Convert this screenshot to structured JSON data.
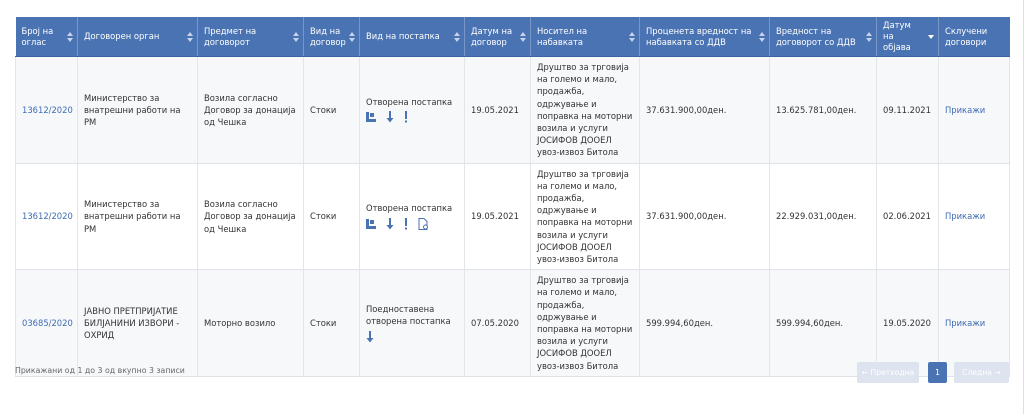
{
  "table": {
    "headers": [
      {
        "label": "Број на оглас",
        "sort": "both"
      },
      {
        "label": "Договорен орган",
        "sort": "both"
      },
      {
        "label": "Предмет на договорот",
        "sort": "both"
      },
      {
        "label": "Вид на договор",
        "sort": "both"
      },
      {
        "label": "Вид на постапка",
        "sort": "both"
      },
      {
        "label": "Датум на договор",
        "sort": "both"
      },
      {
        "label": "Носител на набавката",
        "sort": "both"
      },
      {
        "label": "Проценета вредност на набавката со ДДВ",
        "sort": "both"
      },
      {
        "label": "Вредност на договорот со ДДВ",
        "sort": "both"
      },
      {
        "label": "Датум на објава",
        "sort": "desc"
      },
      {
        "label": "Склучени договори",
        "sort": "none"
      }
    ],
    "rows": [
      {
        "notice": "13612/2020",
        "authority": "Министерство за внатрешни работи на РМ",
        "subject": "Возила согласно Договор за донација од Чешка",
        "contract_type": "Стоки",
        "procedure": "Отворена постапка",
        "procedure_icons": [
          "corner-doc-icon",
          "download-arrow-icon",
          "exclamation-icon"
        ],
        "contract_date": "19.05.2021",
        "holder": "Друштво за трговија на големо и мало, продажба, одржување и поправка на моторни возила и услуги ЈОСИФОВ ДООЕЛ увоз-извоз Битола",
        "estimated": "37.631.900,00ден.",
        "value": "13.625.781,00ден.",
        "published": "09.11.2021",
        "link": "Прикажи"
      },
      {
        "notice": "13612/2020",
        "authority": "Министерство за внатрешни работи на РМ",
        "subject": "Возила согласно Договор за донација од Чешка",
        "contract_type": "Стоки",
        "procedure": "Отворена постапка",
        "procedure_icons": [
          "corner-doc-icon",
          "download-arrow-icon",
          "exclamation-icon",
          "document-gear-icon"
        ],
        "contract_date": "19.05.2021",
        "holder": "Друштво за трговија на големо и мало, продажба, одржување и поправка на моторни возила и услуги ЈОСИФОВ ДООЕЛ увоз-извоз Битола",
        "estimated": "37.631.900,00ден.",
        "value": "22.929.031,00ден.",
        "published": "02.06.2021",
        "link": "Прикажи"
      },
      {
        "notice": "03685/2020",
        "authority": "ЈАВНО ПРЕТПРИЈАТИЕ БИЛЈАНИНИ ИЗВОРИ - ОХРИД",
        "subject": "Моторно возило",
        "contract_type": "Стоки",
        "procedure": "Поедноставена отворена постапка",
        "procedure_icons": [
          "download-arrow-icon"
        ],
        "contract_date": "07.05.2020",
        "holder": "Друштво за трговија на големо и мало, продажба, одржување и поправка на моторни возила и услуги ЈОСИФОВ ДООЕЛ увоз-извоз Битола",
        "estimated": "599.994,60ден.",
        "value": "599.994,60ден.",
        "published": "19.05.2020",
        "link": "Прикажи"
      }
    ]
  },
  "footer": {
    "info": "Прикажани од 1 до 3 од вкупно 3 записи"
  },
  "pagination": {
    "prev": "← Претходна",
    "current_page": "1",
    "next": "Следна →"
  },
  "colors": {
    "header_bg": "#4a73b3",
    "link": "#3d6cb4",
    "icon": "#4a73b3"
  }
}
